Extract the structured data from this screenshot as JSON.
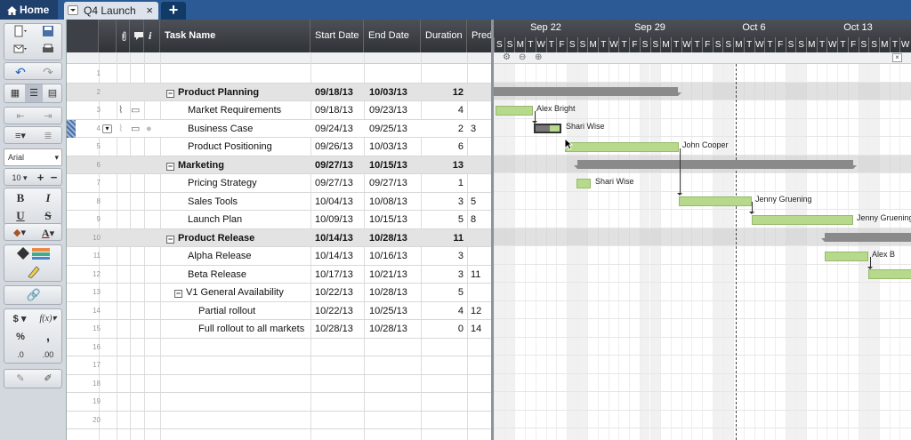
{
  "top": {
    "home_label": "Home",
    "sheet_tab_label": "Q4 Launch",
    "close_symbol": "×",
    "add_tab_symbol": "+"
  },
  "toolbar": {
    "font_family": "Arial",
    "font_size": "10",
    "bold": "B",
    "italic": "I",
    "underline": "U",
    "strike": "S",
    "text_color": "A",
    "currency": "$",
    "formula": "f(x)",
    "percent": "%",
    "comma": ",",
    "dec_less": ".0",
    "dec_more": ".00"
  },
  "grid": {
    "headers": {
      "info": "i",
      "task_name": "Task Name",
      "start_date": "Start Date",
      "end_date": "End Date",
      "duration": "Duration",
      "predecessors": "Pred"
    },
    "rows": [
      {
        "num": "1",
        "name": "",
        "start": "",
        "end": "",
        "dur": "",
        "pred": "",
        "parent": false
      },
      {
        "num": "2",
        "name": "Product Planning",
        "start": "09/18/13",
        "end": "10/03/13",
        "dur": "12",
        "pred": "",
        "parent": true
      },
      {
        "num": "3",
        "name": "Market Requirements",
        "start": "09/18/13",
        "end": "09/23/13",
        "dur": "4",
        "pred": "",
        "parent": false
      },
      {
        "num": "4",
        "name": "Business Case",
        "start": "09/24/13",
        "end": "09/25/13",
        "dur": "2",
        "pred": "3",
        "parent": false
      },
      {
        "num": "5",
        "name": "Product Positioning",
        "start": "09/26/13",
        "end": "10/03/13",
        "dur": "6",
        "pred": "",
        "parent": false
      },
      {
        "num": "6",
        "name": "Marketing",
        "start": "09/27/13",
        "end": "10/15/13",
        "dur": "13",
        "pred": "",
        "parent": true
      },
      {
        "num": "7",
        "name": "Pricing Strategy",
        "start": "09/27/13",
        "end": "09/27/13",
        "dur": "1",
        "pred": "",
        "parent": false
      },
      {
        "num": "8",
        "name": "Sales Tools",
        "start": "10/04/13",
        "end": "10/08/13",
        "dur": "3",
        "pred": "5",
        "parent": false
      },
      {
        "num": "9",
        "name": "Launch Plan",
        "start": "10/09/13",
        "end": "10/15/13",
        "dur": "5",
        "pred": "8",
        "parent": false
      },
      {
        "num": "10",
        "name": "Product Release",
        "start": "10/14/13",
        "end": "10/28/13",
        "dur": "11",
        "pred": "",
        "parent": true
      },
      {
        "num": "11",
        "name": "Alpha Release",
        "start": "10/14/13",
        "end": "10/16/13",
        "dur": "3",
        "pred": "",
        "parent": false
      },
      {
        "num": "12",
        "name": "Beta Release",
        "start": "10/17/13",
        "end": "10/21/13",
        "dur": "3",
        "pred": "11",
        "parent": false
      },
      {
        "num": "13",
        "name": "V1 General Availability",
        "start": "10/22/13",
        "end": "10/28/13",
        "dur": "5",
        "pred": "",
        "parent": false
      },
      {
        "num": "14",
        "name": "Partial rollout",
        "start": "10/22/13",
        "end": "10/25/13",
        "dur": "4",
        "pred": "12",
        "parent": false
      },
      {
        "num": "15",
        "name": "Full rollout to all markets",
        "start": "10/28/13",
        "end": "10/28/13",
        "dur": "0",
        "pred": "14",
        "parent": false
      },
      {
        "num": "16",
        "name": "",
        "start": "",
        "end": "",
        "dur": "",
        "pred": "",
        "parent": false
      },
      {
        "num": "17",
        "name": "",
        "start": "",
        "end": "",
        "dur": "",
        "pred": "",
        "parent": false
      },
      {
        "num": "18",
        "name": "",
        "start": "",
        "end": "",
        "dur": "",
        "pred": "",
        "parent": false
      },
      {
        "num": "19",
        "name": "",
        "start": "",
        "end": "",
        "dur": "",
        "pred": "",
        "parent": false
      },
      {
        "num": "20",
        "name": "",
        "start": "",
        "end": "",
        "dur": "",
        "pred": "",
        "parent": false
      }
    ]
  },
  "gantt": {
    "weeks": [
      "Sep 22",
      "Sep 29",
      "Oct 6",
      "Oct 13"
    ],
    "day_letters": [
      "S",
      "S",
      "M",
      "T",
      "W",
      "T",
      "F",
      "S",
      "S",
      "M",
      "T",
      "W",
      "T",
      "F",
      "S",
      "S",
      "M",
      "T",
      "W",
      "T",
      "F",
      "S",
      "S",
      "M",
      "T",
      "W",
      "T",
      "F",
      "S",
      "S",
      "M",
      "T",
      "W",
      "T",
      "F",
      "S",
      "S",
      "M",
      "T",
      "W"
    ],
    "assignees": {
      "r3": "Alex Bright",
      "r4": "Shari Wise",
      "r5": "John Cooper",
      "r7": "Shari Wise",
      "r8": "Jenny Gruening",
      "r9": "Jenny Gruening",
      "r11": "Alex B"
    }
  },
  "colors": {
    "bar_fill": "#b7d98b",
    "summary_bar": "#8a8a8a",
    "header_bg": "#3a3d42",
    "topbar": "#2b5a94"
  }
}
